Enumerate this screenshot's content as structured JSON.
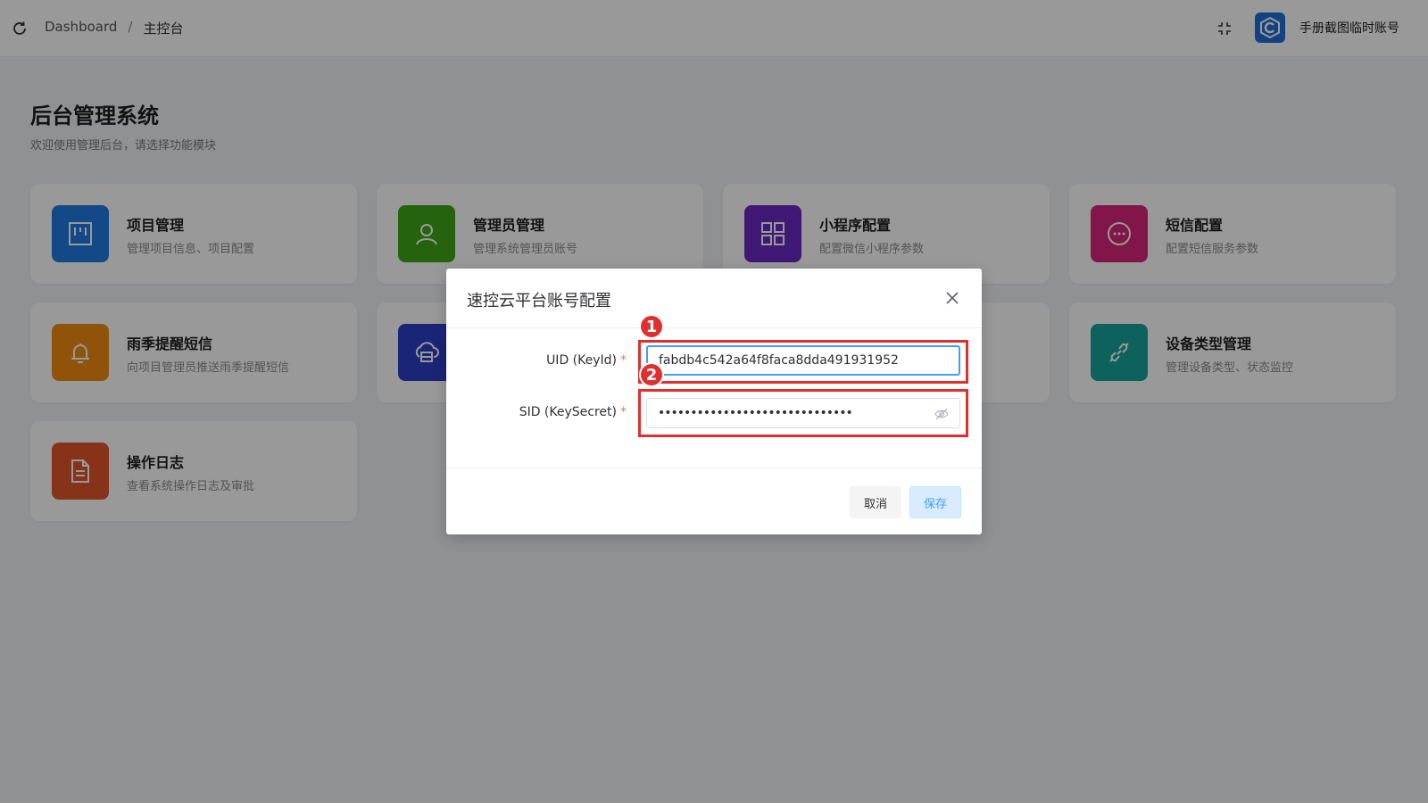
{
  "header": {
    "breadcrumb": [
      "Dashboard",
      "/",
      "主控台"
    ],
    "username": "手册截图临时账号"
  },
  "page": {
    "title": "后台管理系统",
    "subtitle": "欢迎使用管理后台，请选择功能模块"
  },
  "cards": [
    {
      "title": "项目管理",
      "desc": "管理项目信息、项目配置",
      "color": "#1e7be0",
      "icon": "project-icon"
    },
    {
      "title": "管理员管理",
      "desc": "管理系统管理员账号",
      "color": "#3fa51a",
      "icon": "user-icon"
    },
    {
      "title": "小程序配置",
      "desc": "配置微信小程序参数",
      "color": "#6a2bc4",
      "icon": "grid-icon"
    },
    {
      "title": "短信配置",
      "desc": "配置短信服务参数",
      "color": "#d9267a",
      "icon": "chat-icon"
    },
    {
      "title": "雨季提醒短信",
      "desc": "向项目管理员推送雨季提醒短信",
      "color": "#f08b12",
      "icon": "bell-icon"
    },
    {
      "title": "",
      "desc": "",
      "color": "#2d3fc7",
      "icon": "cloud-server-icon"
    },
    {
      "title": "",
      "desc": "",
      "color": "#2c7fe0",
      "icon": "hidden-icon"
    },
    {
      "title": "设备类型管理",
      "desc": "管理设备类型、状态监控",
      "color": "#16a39c",
      "icon": "link-icon"
    },
    {
      "title": "操作日志",
      "desc": "查看系统操作日志及审批",
      "color": "#e2562b",
      "icon": "document-icon"
    }
  ],
  "dialog": {
    "title": "速控云平台账号配置",
    "uid_label": "UID (KeyId)",
    "uid_value": "fabdb4c542a64f8faca8dda491931952",
    "sid_label": "SID (KeySecret)",
    "sid_value": "••••••••••••••••••••••••••••••",
    "required_mark": "*",
    "cancel_label": "取消",
    "save_label": "保存"
  },
  "annotations": {
    "badge1": "1",
    "badge2": "2",
    "color": "#e02f2f"
  }
}
